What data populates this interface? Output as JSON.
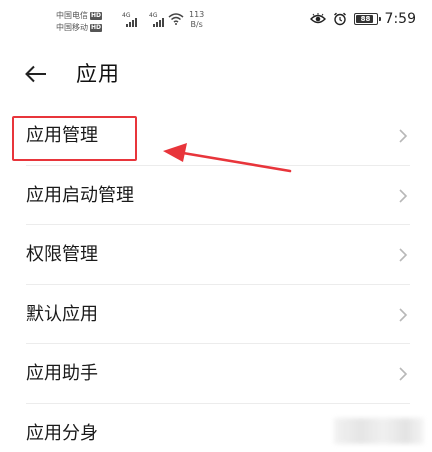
{
  "status_bar": {
    "carrier_1": "中国电信",
    "carrier_2": "中国移动",
    "hd_badge": "HD",
    "network_1": "4G",
    "network_2": "4G",
    "speed_value": "113",
    "speed_unit": "B/s",
    "battery_level_text": "88",
    "battery_level": 0.88,
    "time": "7:59",
    "icons": [
      "signal-icon",
      "wifi-icon",
      "eye-comfort-icon",
      "alarm-icon",
      "battery-icon"
    ]
  },
  "header": {
    "back_icon": "back-arrow-icon",
    "title": "应用"
  },
  "menu": {
    "items": [
      {
        "label": "应用管理",
        "highlighted": true
      },
      {
        "label": "应用启动管理"
      },
      {
        "label": "权限管理"
      },
      {
        "label": "默认应用"
      },
      {
        "label": "应用助手"
      },
      {
        "label": "应用分身"
      }
    ]
  },
  "annotation": {
    "color": "#e8353b",
    "icon": "red-arrow-annotation"
  }
}
